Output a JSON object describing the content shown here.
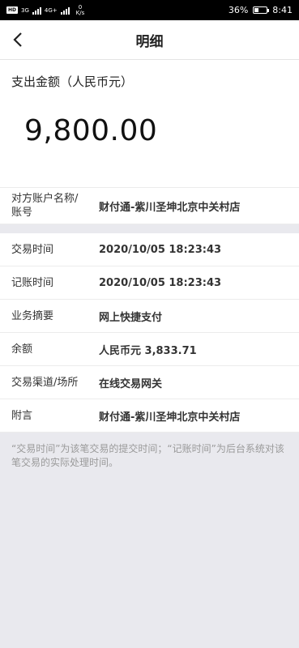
{
  "status_bar": {
    "chip": "HD",
    "net1": "3G",
    "net2": "4G+",
    "speed_value": "0",
    "speed_unit": "K/s",
    "battery_percent": "36%",
    "battery_level": 0.36,
    "time": "8:41"
  },
  "header": {
    "back_icon": "chevron-left-icon",
    "title": "明细"
  },
  "amount": {
    "label": "支出金额（人民币元）",
    "value": "9,800.00"
  },
  "counterparty": {
    "label_line1": "对方账户名称/",
    "label_line2": "账号",
    "value": "财付通-紫川圣坤北京中关村店"
  },
  "details": [
    {
      "label": "交易时间",
      "value": "2020/10/05  18:23:43"
    },
    {
      "label": "记账时间",
      "value": "2020/10/05  18:23:43"
    },
    {
      "label": "业务摘要",
      "value": "网上快捷支付"
    },
    {
      "label": "余额",
      "value": "人民币元 3,833.71"
    },
    {
      "label": "交易渠道/场所",
      "value": "在线交易网关"
    },
    {
      "label": "附言",
      "value": "财付通-紫川圣坤北京中关村店"
    }
  ],
  "note": "“交易时间”为该笔交易的提交时间；“记账时间”为后台系统对该笔交易的实际处理时间。"
}
